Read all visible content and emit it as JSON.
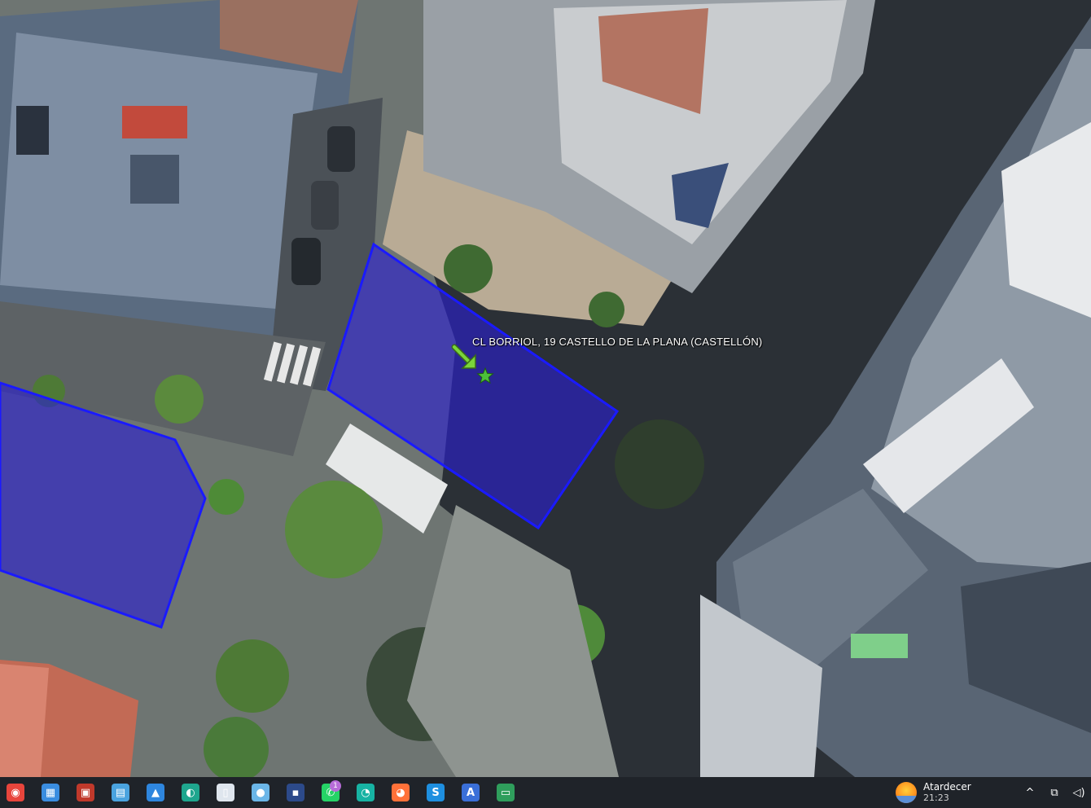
{
  "map": {
    "label": "CL BORRIOL, 19  CASTELLO DE LA PLANA (CASTELLÓN)",
    "parcel_outline_color": "#1a1aff",
    "parcel_fill_color": "#2a1fd0",
    "marker_arrow_color": "#7ad53a",
    "marker_star_color": "#4cc03a"
  },
  "taskbar": {
    "icons": [
      {
        "name": "chrome-icon",
        "glyph": "◉",
        "color": "#e8453c",
        "badge": ""
      },
      {
        "name": "maps-app-icon",
        "glyph": "▦",
        "color": "#3a8de0",
        "badge": ""
      },
      {
        "name": "photos-app-icon",
        "glyph": "▣",
        "color": "#c0392b",
        "badge": ""
      },
      {
        "name": "store-lock-icon",
        "glyph": "▤",
        "color": "#4aa3df",
        "badge": ""
      },
      {
        "name": "gallery-icon",
        "glyph": "▲",
        "color": "#2e86de",
        "badge": ""
      },
      {
        "name": "edge-icon",
        "glyph": "◐",
        "color": "#1fa68e",
        "badge": ""
      },
      {
        "name": "document-icon",
        "glyph": "▯",
        "color": "#dfe6ee",
        "badge": ""
      },
      {
        "name": "globe-icon",
        "glyph": "●",
        "color": "#6bb6e8",
        "badge": ""
      },
      {
        "name": "floppy-save-icon",
        "glyph": "▪",
        "color": "#2c4a8a",
        "badge": ""
      },
      {
        "name": "whatsapp-icon",
        "glyph": "✆",
        "color": "#25d366",
        "badge": "1"
      },
      {
        "name": "wave-app-icon",
        "glyph": "◔",
        "color": "#17b3a3",
        "badge": ""
      },
      {
        "name": "firefox-icon",
        "glyph": "◕",
        "color": "#ff7139",
        "badge": ""
      },
      {
        "name": "s-app-icon",
        "glyph": "S",
        "color": "#1e8fe0",
        "badge": ""
      },
      {
        "name": "arrow-app-icon",
        "glyph": "A",
        "color": "#3a6fd8",
        "badge": ""
      },
      {
        "name": "window-app-icon",
        "glyph": "▭",
        "color": "#2f9e5c",
        "badge": ""
      }
    ],
    "weather": {
      "label": "Atardecer",
      "time": "21:23"
    },
    "tray": {
      "chevron": "^",
      "monitor": "⧉",
      "volume": "◁)"
    }
  }
}
